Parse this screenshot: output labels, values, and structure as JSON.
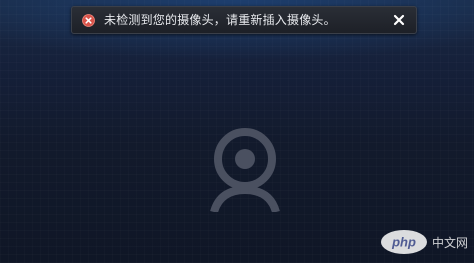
{
  "notification": {
    "message": "未检测到您的摄像头，请重新插入摄像头。",
    "status": "error"
  },
  "icons": {
    "error": "error-icon",
    "close": "close-icon",
    "camera": "webcam-icon"
  },
  "watermark": {
    "brand": "php",
    "site": "中文网"
  },
  "colors": {
    "error_red": "#d9534a",
    "accent_blue": "#1d3e6e",
    "camera_gray": "#4a5060"
  }
}
